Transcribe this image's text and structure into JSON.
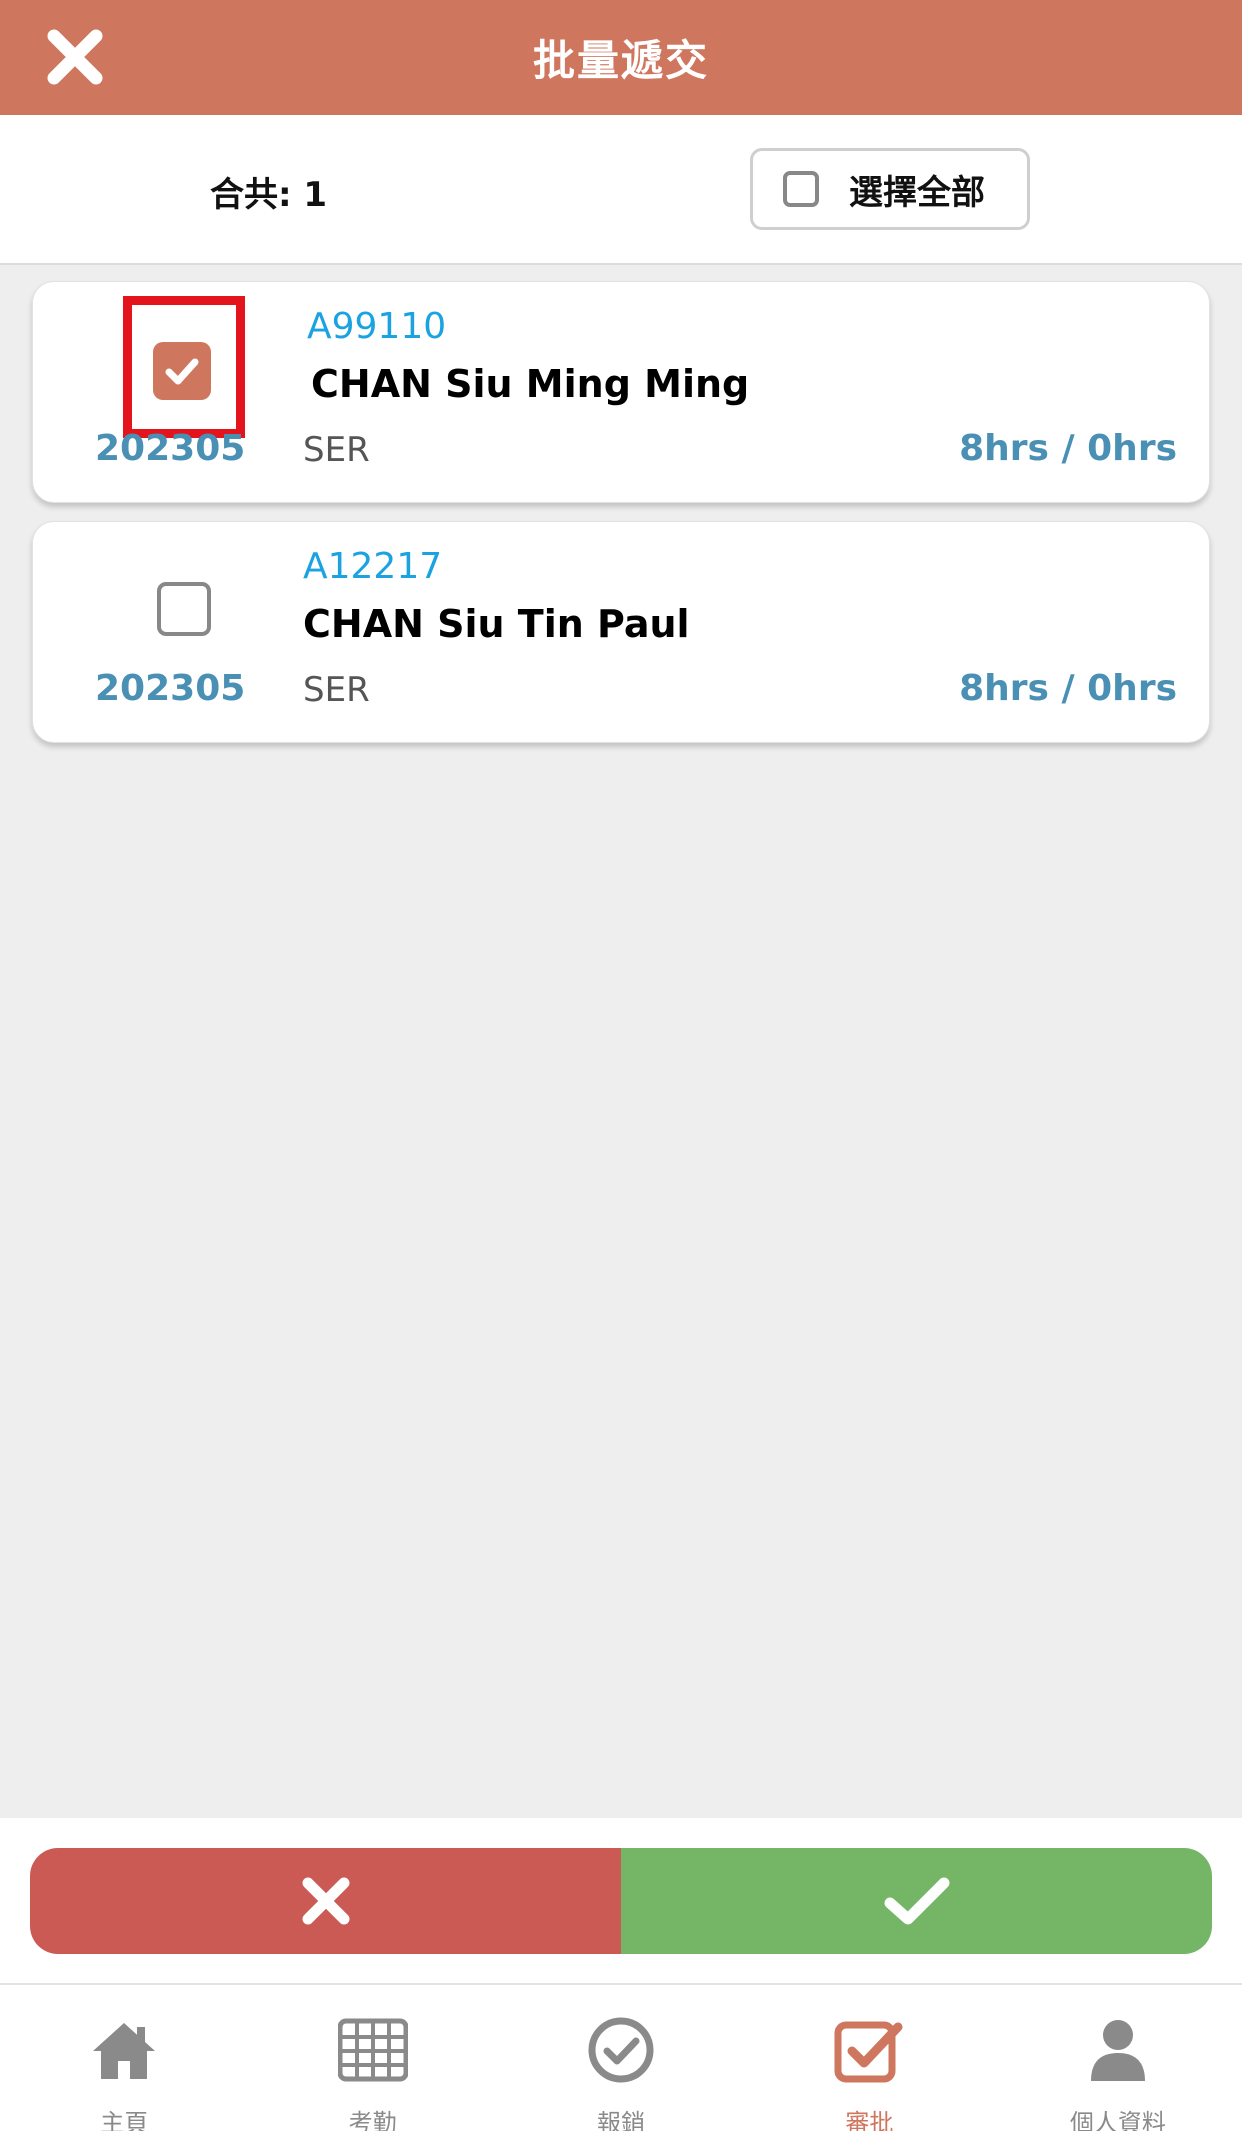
{
  "header": {
    "title": "批量遞交",
    "close_icon": "close-icon"
  },
  "summary": {
    "total_text": "合共: 1",
    "select_all_label": "選擇全部"
  },
  "records": [
    {
      "period": "202305",
      "id": "A99110",
      "name": "CHAN Siu Ming Ming",
      "type": "SER",
      "hours": "8hrs / 0hrs",
      "checked": true
    },
    {
      "period": "202305",
      "id": "A12217",
      "name": "CHAN Siu Tin Paul",
      "type": "SER",
      "hours": "8hrs / 0hrs",
      "checked": false
    }
  ],
  "actions": {
    "reject_icon": "close-icon",
    "approve_icon": "check-icon"
  },
  "tabs": [
    {
      "label": "主頁",
      "icon": "home-icon"
    },
    {
      "label": "考勤",
      "icon": "grid-icon"
    },
    {
      "label": "報銷",
      "icon": "check-circle-icon"
    },
    {
      "label": "審批",
      "icon": "checkbox-icon",
      "active": true
    },
    {
      "label": "個人資料",
      "icon": "user-icon"
    }
  ],
  "colors": {
    "header": "#cf765e",
    "accent_blue": "#4a90b5",
    "id_blue": "#1aa3e0",
    "reject": "#cb5a55",
    "approve": "#74b666",
    "highlight": "#e3141c"
  }
}
